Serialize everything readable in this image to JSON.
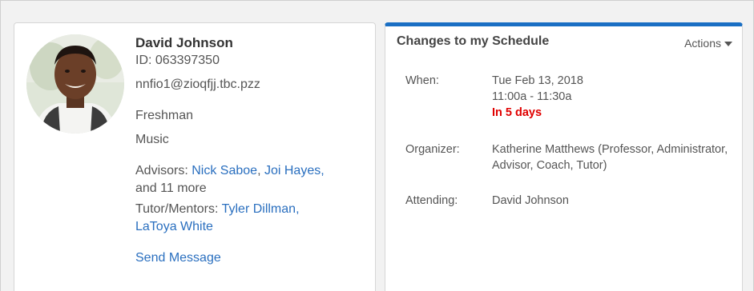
{
  "profile": {
    "name": "David Johnson",
    "id": "ID: 063397350",
    "email": "nnfio1@zioqfjj.tbc.pzz",
    "year": "Freshman",
    "major": "Music",
    "advisors_label": "Advisors: ",
    "advisor_1": "Nick Saboe",
    "advisor_sep": ", ",
    "advisor_2": "Joi Hayes",
    "advisor_comma": ",",
    "advisors_more": "and 11 more",
    "tutors_label": "Tutor/Mentors: ",
    "tutor_1": "Tyler Dillman",
    "tutor_comma": ",",
    "tutor_2": "LaToya White",
    "send_message": "Send Message"
  },
  "schedule": {
    "title": "Changes to my Schedule",
    "actions_label": "Actions",
    "accent_color": "#1a6fc4",
    "when_label": "When:",
    "when_date": "Tue Feb 13, 2018",
    "when_time": "11:00a - 11:30a",
    "when_relative": "In 5 days",
    "organizer_label": "Organizer:",
    "organizer_value": "Katherine Matthews (Professor, Administrator, Advisor, Coach, Tutor)",
    "attending_label": "Attending:",
    "attending_value": "David Johnson"
  }
}
